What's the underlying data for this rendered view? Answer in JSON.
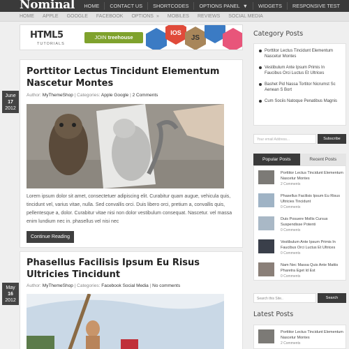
{
  "site": {
    "name": "Nominal"
  },
  "top_nav": {
    "items": [
      "HOME",
      "CONTACT US",
      "SHORTCODES",
      "OPTIONS PANEL",
      "WIDGETS",
      "RESPONSIVE TEST"
    ]
  },
  "secondary_nav": {
    "items": [
      "HOME",
      "APPLE",
      "GOOGLE",
      "FACEBOOK",
      "OPTIONS",
      "MOBILES",
      "REVIEWS",
      "SOCIAL MEDIA"
    ]
  },
  "ad_banner": {
    "headline": "HTML5",
    "subline": "TUTORIALS",
    "button_prefix": "JOIN",
    "button_brand": "treehouse",
    "tiles": [
      "IOS",
      "JS"
    ]
  },
  "posts": [
    {
      "title": "Porttitor Lectus Tincidunt Elementum Nascetur Montes",
      "date_month": "June",
      "date_day": "17",
      "date_year": "2012",
      "author_label": "Author:",
      "author": "MyThemeShop",
      "categories_label": "Categories:",
      "categories": "Apple Google",
      "comments": "2 Comments",
      "excerpt": "Lorem ipsum dolor sit amet, consectetuer adipiscing elit. Curabitur quam augue, vehicula quis, tincidunt vel, varius vitae, nulla. Sed convallis orci. Duis libero orci, pretium a, convallis quis, pellentesque a, dolor. Curabitur vitae nisi non dolor vestibulum consequat. Nascetur. vel massa enim lundium nec in. phasellus vel nisi nec",
      "button": "Continue Reading"
    },
    {
      "title": "Phasellus Facilisis Ipsum Eu Risus Ultricies Tincidunt",
      "date_month": "May",
      "date_day": "16",
      "date_year": "2012",
      "author_label": "Author:",
      "author": "MyThemeShop",
      "categories_label": "Categories:",
      "categories": "Facebook Social Media",
      "comments": "No comments"
    }
  ],
  "sidebar": {
    "category_posts_title": "Category Posts",
    "category_posts": [
      "Porttitor Lectus Tincidunt Elementum Nascetur Montes",
      "Vestibulum Ante Ipsum Primis In Faucibus Orci Luctus Et Ultrices",
      "Bashet Pid Nassa Tortitor Nicrumst Sc Aenean S Bort",
      "Cum Sociis Natoque Penatibus Magnis"
    ],
    "subscribe": {
      "placeholder": "Your email Address...",
      "button": "Subscribe"
    },
    "tabs": {
      "popular": "Popular Posts",
      "recent": "Recent Posts"
    },
    "popular_posts": [
      {
        "title": "Porttitor Lectus Tincidunt Elementum Nascetur Montes",
        "comments": "2 Comments",
        "thumb_color": "#7c7a76"
      },
      {
        "title": "Phasellus Facilisis Ipsum Eu Risus Ultricies Tincidunt",
        "comments": "0 Comments",
        "thumb_color": "#9fb3c5"
      },
      {
        "title": "Duis Posuere Mollis Cursus Suspendisse Potenti",
        "comments": "0 Comments",
        "thumb_color": "#a9b8c6"
      },
      {
        "title": "Vestibulum Ante Ipsum Primis In Faucibus Orci Luctus Et Ultrices",
        "comments": "0 Comments",
        "thumb_color": "#3a3f4a"
      },
      {
        "title": "Nam Nec Massa Quis Ante Mattis Pharetra Eget Id Est",
        "comments": "0 Comments",
        "thumb_color": "#8a7f78"
      }
    ],
    "search": {
      "placeholder": "Search this Site..",
      "button": "Search"
    },
    "latest_posts_title": "Latest Posts",
    "latest_posts": [
      {
        "title": "Porttitor Lectus Tincidunt Elementum Nascetur Montes",
        "comments": "2 Comments",
        "thumb_color": "#7c7a76"
      }
    ]
  },
  "colors": {
    "topbar": "#3a3a3a",
    "accent_green": "#7fa22d",
    "tile_red": "#e04a3a",
    "tile_blue": "#3b7bc4",
    "tile_tan": "#a8865a",
    "tile_pink": "#e8557a"
  }
}
